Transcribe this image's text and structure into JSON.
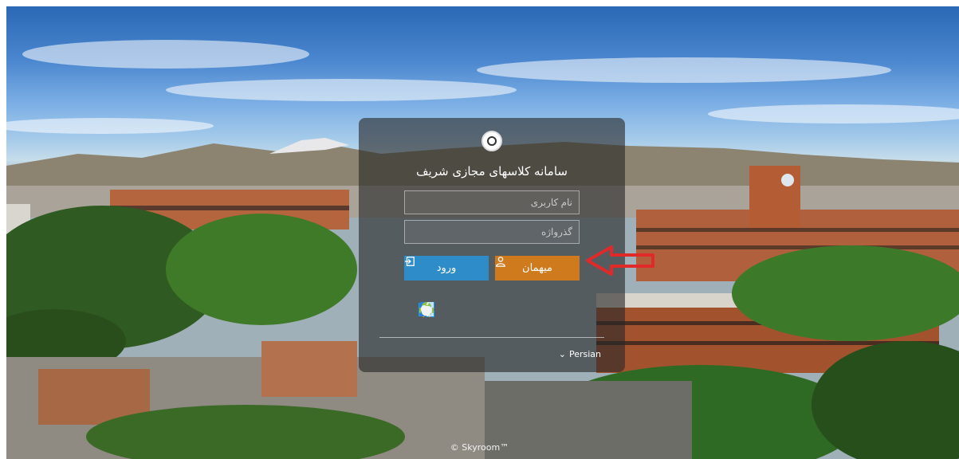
{
  "login": {
    "title": "سامانه کلاسهای مجازی شریف",
    "username_placeholder": "نام کاربری",
    "password_placeholder": "گذرواژه",
    "login_label": "ورود",
    "guest_label": "میهمان"
  },
  "platforms": [
    "windows-icon",
    "linux-icon",
    "mac-finder-icon",
    "android-icon",
    "apple-icon"
  ],
  "language": {
    "selected": "Persian"
  },
  "footer": {
    "text": "© Skyroom™"
  },
  "colors": {
    "login_button": "#2e8cc9",
    "guest_button": "#cf7a1c",
    "arrow": "#e02a2a"
  }
}
